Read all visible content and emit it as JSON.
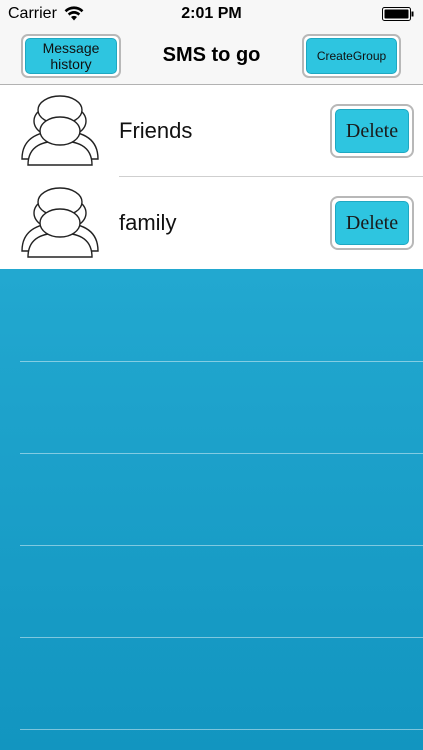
{
  "status_bar": {
    "carrier": "Carrier",
    "time": "2:01 PM",
    "wifi_icon": "wifi-icon",
    "battery_icon": "battery-icon"
  },
  "nav": {
    "title": "SMS to go",
    "history_button": "Message history",
    "create_button": "CreateGroup"
  },
  "groups": [
    {
      "name": "Friends",
      "delete_label": "Delete",
      "icon": "group-avatar-icon"
    },
    {
      "name": "family",
      "delete_label": "Delete",
      "icon": "group-avatar-icon"
    }
  ],
  "colors": {
    "button_fill": "#2ec5e0",
    "empty_area": "#1a9fc8",
    "nav_background": "#f7f7f7"
  }
}
